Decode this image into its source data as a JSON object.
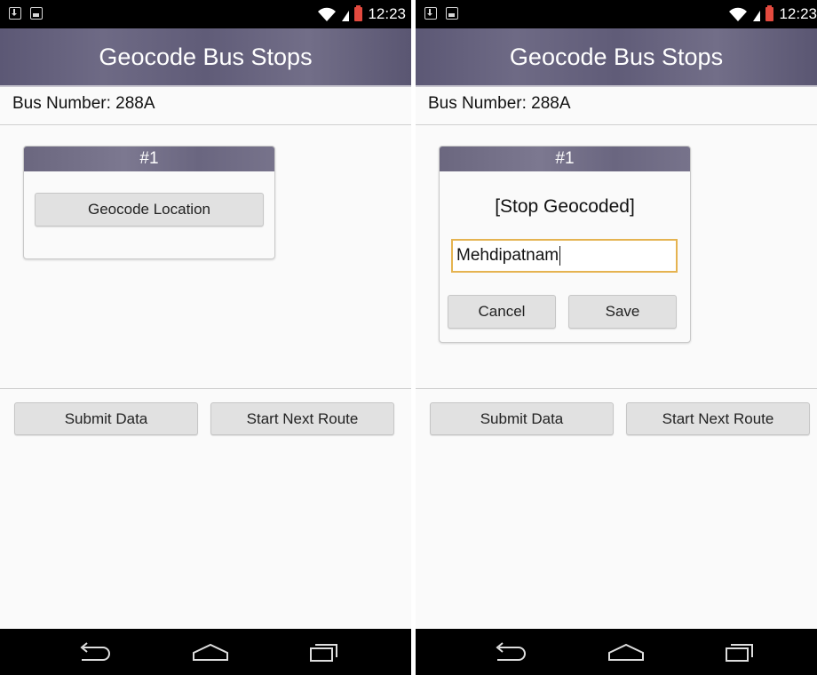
{
  "status_bar": {
    "time": "12:23"
  },
  "app": {
    "title": "Geocode Bus Stops"
  },
  "route": {
    "bus_number_label": "Bus Number: 288A"
  },
  "left_screen": {
    "stop_card": {
      "header": "#1",
      "geocode_button": "Geocode Location"
    }
  },
  "right_screen": {
    "stop_card": {
      "header": "#1",
      "status_text": "[Stop Geocoded]",
      "stop_name_value": "Mehdipatnam",
      "cancel_button": "Cancel",
      "save_button": "Save"
    }
  },
  "footer_buttons": {
    "submit": "Submit Data",
    "next_route": "Start Next Route"
  },
  "icons": {
    "status": [
      "download-notification-icon",
      "image-notification-icon",
      "wifi-icon",
      "signal-icon",
      "battery-icon"
    ],
    "nav": [
      "back-icon",
      "home-icon",
      "recents-icon"
    ]
  },
  "colors": {
    "accent_input_border": "#e5b350",
    "battery": "#e34a3f",
    "app_bar": "#65617c"
  }
}
